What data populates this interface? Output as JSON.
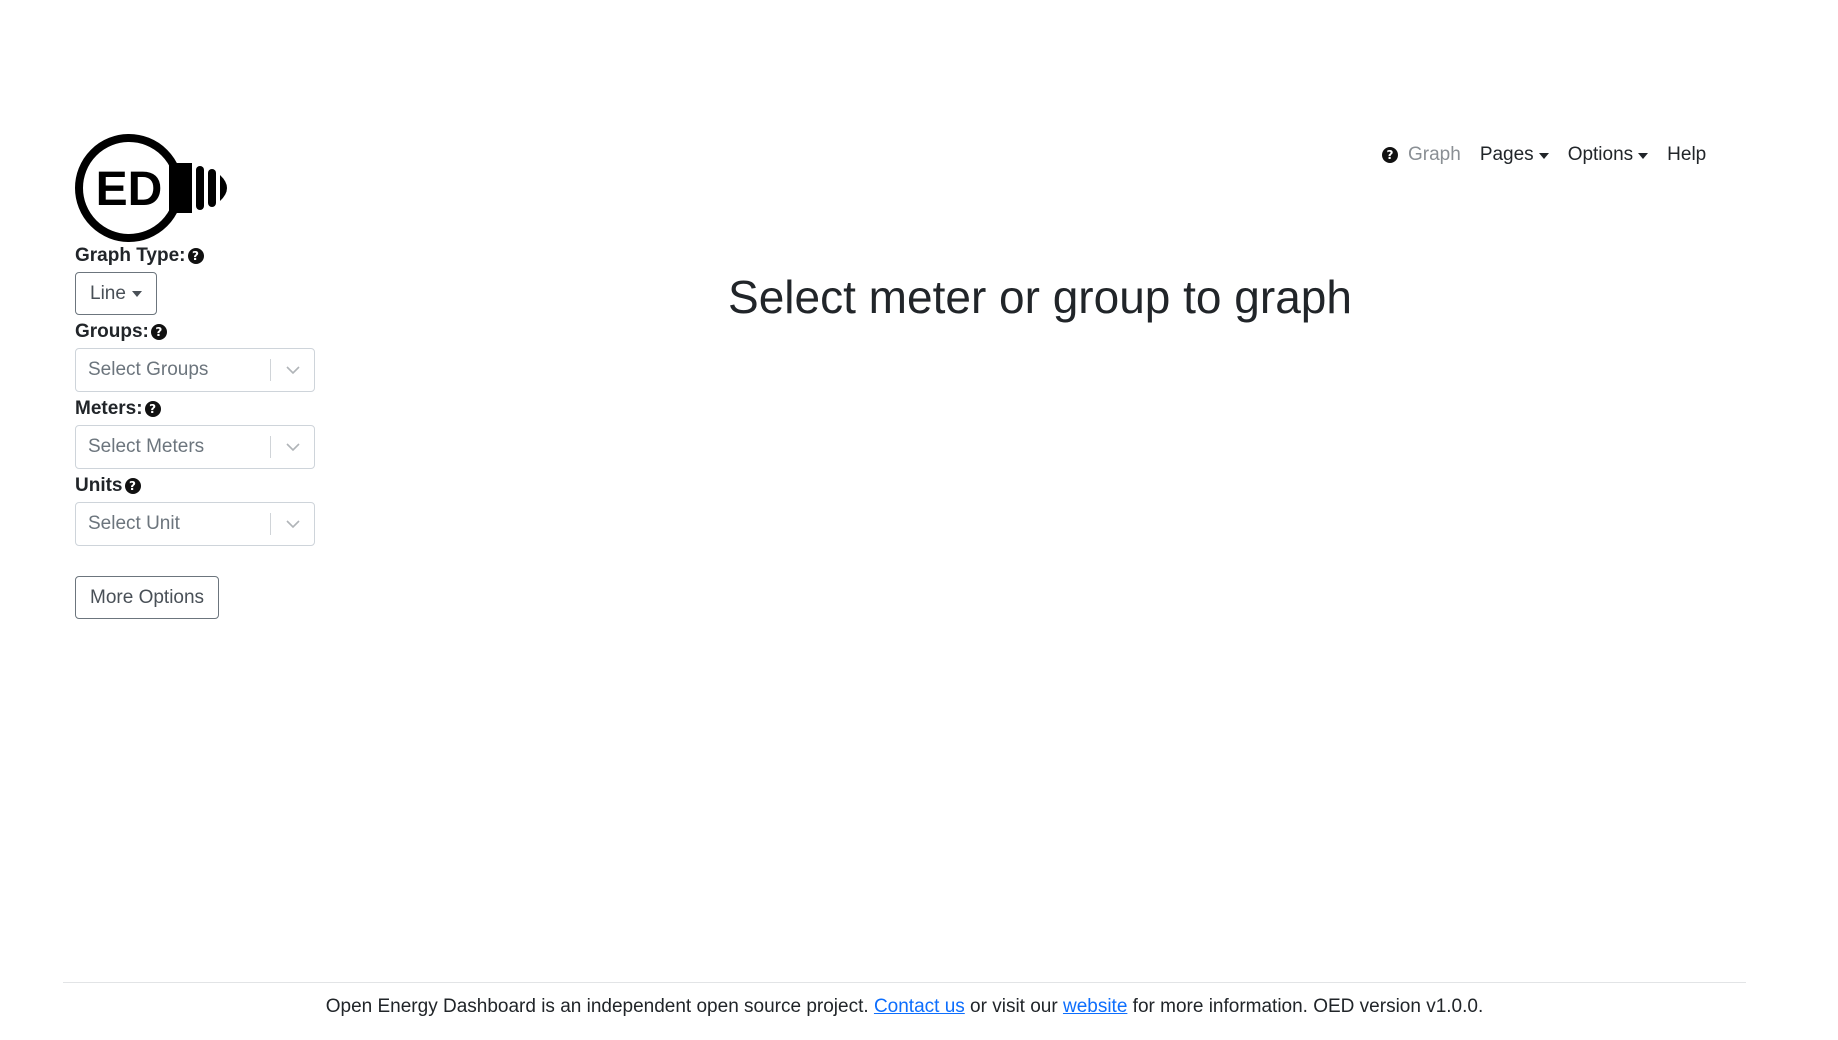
{
  "logo": {
    "text": "ED"
  },
  "nav": {
    "graph_label": "Graph",
    "pages_label": "Pages",
    "options_label": "Options",
    "help_label": "Help"
  },
  "sidebar": {
    "graph_type_label": "Graph Type:",
    "graph_type_value": "Line",
    "groups_label": "Groups:",
    "groups_placeholder": "Select Groups",
    "meters_label": "Meters:",
    "meters_placeholder": "Select Meters",
    "units_label": "Units",
    "units_placeholder": "Select Unit",
    "more_options_label": "More Options"
  },
  "main": {
    "title": "Select meter or group to graph"
  },
  "footer": {
    "text_1": "Open Energy Dashboard is an independent open source project. ",
    "contact_link": "Contact us",
    "text_2": " or visit our ",
    "website_link": "website",
    "text_3": " for more information. OED version v1.0.0."
  },
  "colors": {
    "link": "#0d6efd",
    "text": "#212529",
    "muted": "#6c757d"
  }
}
